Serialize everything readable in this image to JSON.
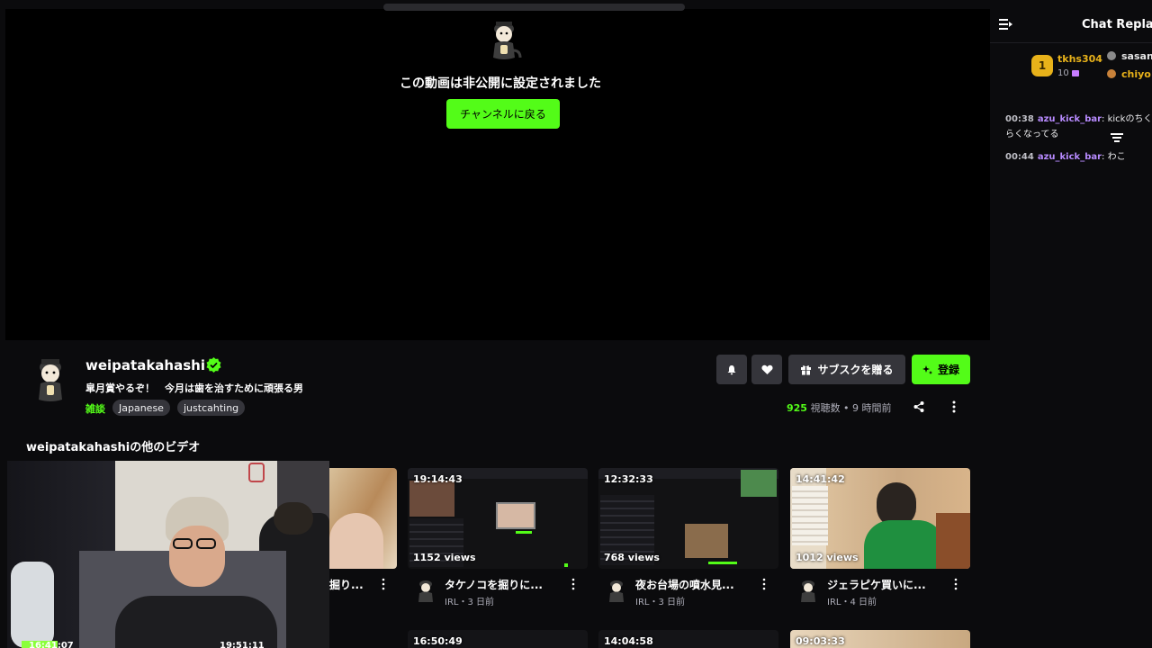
{
  "player": {
    "private_message": "この動画は非公開に設定されました",
    "back_button": "チャンネルに戻る"
  },
  "chat": {
    "title": "Chat Replay",
    "top_gifter": {
      "rank": "1",
      "name": "tkhs304",
      "count": "10"
    },
    "gifter2": "sasan",
    "gifter3": "chiyo",
    "messages": [
      {
        "time": "00:38",
        "user": "azu_kick_bar",
        "text": ": kickのちくらくなってる"
      },
      {
        "time": "00:44",
        "user": "azu_kick_bar",
        "text": ": わこ"
      }
    ]
  },
  "channel": {
    "name": "weipatakahashi",
    "title": "皐月賞やるぞ！　今月は歯を治すために頑張る男",
    "category": "雑談",
    "tags": [
      "Japanese",
      "justcahting"
    ],
    "subscribe_gift_label": "サブスクを贈る",
    "follow_label": "登録",
    "views_count": "925",
    "views_label": "視聴数",
    "separator": "•",
    "time_ago": "9 時間前"
  },
  "more_videos": {
    "heading": "weipatakahashiの他のビデオ",
    "partial_title": "掘り...",
    "cards": [
      {
        "duration": "19:14:43",
        "views": "1152 views",
        "title": "タケノコを掘りに...",
        "meta": "IRL・3 日前"
      },
      {
        "duration": "12:32:33",
        "views": "768 views",
        "title": "夜お台場の噴水見...",
        "meta": "IRL・3 日前"
      },
      {
        "duration": "14:41:42",
        "views": "1012 views",
        "title": "ジェラピケ買いに...",
        "meta": "IRL・4 日前"
      }
    ],
    "row2": [
      "16:41:07",
      "19:51:11",
      "16:50:49",
      "14:04:58",
      "09:03:33"
    ]
  },
  "colors": {
    "accent": "#53fc18",
    "background": "#0b0b0d",
    "chip": "#35353b",
    "username": "#b88bff",
    "gold": "#e8b21a"
  }
}
